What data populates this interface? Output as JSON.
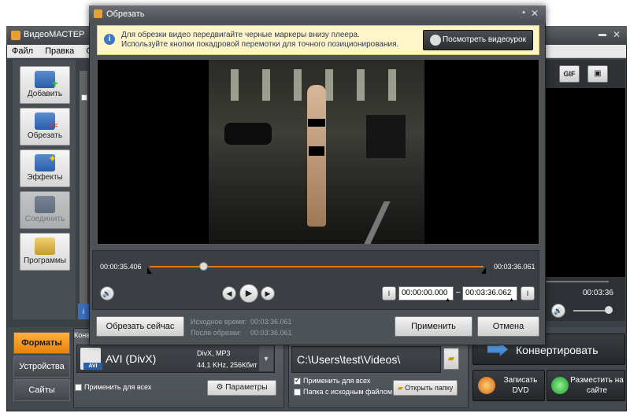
{
  "main_window": {
    "title": "ВидеоМАСТЕР",
    "menu": [
      "Файл",
      "Правка",
      "Обр"
    ],
    "left_buttons": [
      {
        "label": "Добавить",
        "icon": "add-film-icon"
      },
      {
        "label": "Обрезать",
        "icon": "cut-film-icon"
      },
      {
        "label": "Эффекты",
        "icon": "effects-wand-icon"
      },
      {
        "label": "Соединить",
        "icon": "join-film-icon"
      },
      {
        "label": "Программы",
        "icon": "programs-icon"
      }
    ],
    "right_toolbar": {
      "gif": "GIF"
    },
    "right_time": "00:03:36",
    "bottom_tabs": [
      "Форматы",
      "Устройства",
      "Сайты"
    ],
    "format_header": "Конв",
    "format": {
      "name": "AVI (DivX)",
      "badge": "AVI",
      "codec": "DivX, MP3",
      "audio": "44,1 KHz, 256Кбит"
    },
    "apply_all": "Применить для всех",
    "params_button": "Параметры",
    "output_path": "C:\\Users\\test\\Videos\\",
    "apply_all_2": "Применить для всех",
    "source_folder": "Папка с исходным файлом",
    "open_folder": "Открыть папку",
    "convert": "Конвертировать",
    "burn_dvd": "Записать DVD",
    "publish": "Разместить на сайте"
  },
  "dialog": {
    "title": "Обрезать",
    "hint_line1": "Для обрезки видео передвигайте черные маркеры внизу плеера.",
    "hint_line2": "Используйте кнопки покадровой перемотки для точного позиционирования.",
    "tutorial_button": "Посмотреть видеоурок",
    "current_time": "00:00:35.406",
    "end_time": "00:03:36.061",
    "start_field": "00:00:00.000",
    "end_field": "00:03:36.062",
    "range_dash": "–",
    "cut_now": "Обрезать сейчас",
    "orig_time_label": "Исходное время:",
    "orig_time": "00:03:36.061",
    "after_cut_label": "После обрезки:",
    "after_cut": "00:03:36.061",
    "apply": "Применить",
    "cancel": "Отмена",
    "playhead_fraction": 0.16
  }
}
